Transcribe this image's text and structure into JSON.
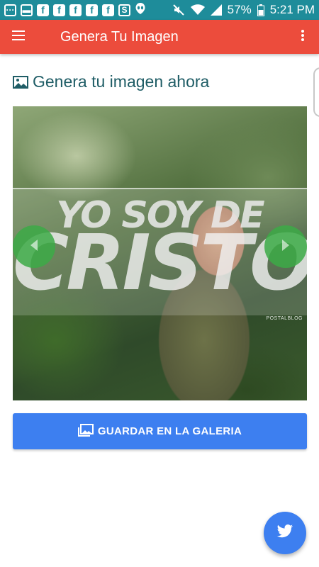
{
  "status_bar": {
    "battery": "57%",
    "time": "5:21 PM",
    "icons": [
      "message-icon",
      "notification-icon",
      "facebook-icon",
      "facebook-icon",
      "facebook-icon",
      "facebook-icon",
      "facebook-icon",
      "s-app-icon",
      "alien-icon",
      "mute-icon",
      "wifi-icon",
      "signal-icon",
      "battery-icon"
    ]
  },
  "app_bar": {
    "title": "Genera Tu Imagen",
    "menu_icon": "hamburger-menu-icon",
    "more_icon": "more-vert-icon",
    "color": "#ec4c3c"
  },
  "main": {
    "heading": "Genera tu imagen ahora",
    "heading_icon": "image-icon",
    "image": {
      "overlay_line1": "YO SOY DE",
      "overlay_line2": "CRISTO",
      "credit": "POSTALBLOG"
    },
    "save_button": {
      "label": "GUARDAR EN LA GALERIA",
      "icon": "gallery-icon",
      "color": "#3d7ff0"
    }
  },
  "fab": {
    "icon": "twitter-icon",
    "color": "#3d7ff0"
  }
}
